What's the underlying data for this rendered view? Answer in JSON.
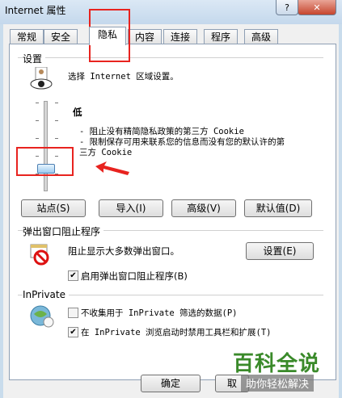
{
  "window": {
    "title": "Internet 属性",
    "help_glyph": "?",
    "close_glyph": "✕"
  },
  "tabs": [
    "常规",
    "安全",
    "隐私",
    "内容",
    "连接",
    "程序",
    "高级"
  ],
  "active_tab": "隐私",
  "settings": {
    "group_label": "设置",
    "zone_text": "选择 Internet 区域设置。",
    "level": "低",
    "desc_line1": "- 阻止没有精简隐私政策的第三方 Cookie",
    "desc_line2": "- 限制保存可用来联系您的信息而没有您的默认许的第",
    "desc_line3": "三方 Cookie",
    "slider_level_fraction": 0.2
  },
  "buttons": {
    "sites": "站点(S)",
    "import": "导入(I)",
    "advanced": "高级(V)",
    "default": "默认值(D)",
    "popup_settings": "设置(E)",
    "ok": "确定",
    "cancel": "取"
  },
  "popup": {
    "group_label": "弹出窗口阻止程序",
    "desc": "阻止显示大多数弹出窗口。",
    "enable_label": "启用弹出窗口阻止程序(B)",
    "enable_checked": true
  },
  "inprivate": {
    "group_label": "InPrivate",
    "no_collect_label": "不收集用于 InPrivate 筛选的数据(P)",
    "no_collect_checked": false,
    "disable_toolbars_label": "在 InPrivate 浏览启动时禁用工具栏和扩展(T)",
    "disable_toolbars_checked": true
  },
  "watermark": {
    "line1": "百科全说",
    "line2": "助你轻松解决"
  },
  "colors": {
    "annotation_red": "#e8231f",
    "watermark_green": "#3a8a2a"
  }
}
